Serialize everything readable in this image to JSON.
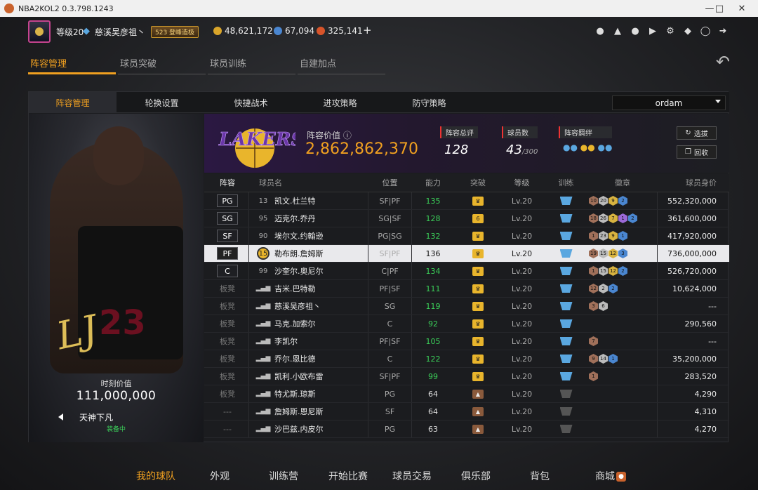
{
  "window": {
    "title": "NBA2KOL2 0.3.798.1243"
  },
  "topbar": {
    "level": "等级20",
    "username": "慈溪吴彦祖丶",
    "badge": "523 登峰造极",
    "coins_gold": "48,621,172",
    "coins_blue": "67,094",
    "coins_red": "325,141",
    "plus": "+"
  },
  "main_tabs": [
    "阵容管理",
    "球员突破",
    "球员训练",
    "自建加点"
  ],
  "sub_tabs": [
    "阵容管理",
    "轮换设置",
    "快捷战术",
    "进攻策略",
    "防守策略"
  ],
  "dropdown": {
    "value": "ordam"
  },
  "card": {
    "value_label": "时刻价值",
    "value": "111,000,000",
    "name": "天神下凡",
    "status": "装备中"
  },
  "team": {
    "lineup_value_label": "阵容价值",
    "lineup_value": "2,862,862,370",
    "rating_label": "阵容总评",
    "rating": "128",
    "count_label": "球员数",
    "count": "43",
    "count_max": "/300",
    "chem_label": "阵容羁绊",
    "btn_select": "选拔",
    "btn_recycle": "回收"
  },
  "table": {
    "headers": [
      "阵容",
      "球员名",
      "位置",
      "能力",
      "突破",
      "等级",
      "训练",
      "徽章",
      "球员身价"
    ],
    "rows": [
      {
        "slot": "PG",
        "starter": true,
        "num": "13",
        "name": "凯文.杜兰特",
        "pos": "SF|PF",
        "ability": "135",
        "level": "Lv.20",
        "value": "552,320,000",
        "break": "gold",
        "badges": [
          [
            "br",
            "10"
          ],
          [
            "si",
            "20"
          ],
          [
            "go",
            "9"
          ],
          [
            "bl",
            "2"
          ]
        ]
      },
      {
        "slot": "SG",
        "starter": true,
        "num": "95",
        "name": "迈克尔.乔丹",
        "pos": "SG|SF",
        "ability": "128",
        "level": "Lv.20",
        "value": "361,600,000",
        "break": "gold6",
        "badges": [
          [
            "br",
            "18"
          ],
          [
            "si",
            "26"
          ],
          [
            "go",
            "7"
          ],
          [
            "pu",
            "1"
          ],
          [
            "bl",
            "2"
          ]
        ]
      },
      {
        "slot": "SF",
        "starter": true,
        "num": "90",
        "name": "埃尔文.约翰逊",
        "pos": "PG|SG",
        "ability": "132",
        "level": "Lv.20",
        "value": "417,920,000",
        "break": "gold",
        "badges": [
          [
            "br",
            "1"
          ],
          [
            "si",
            "23"
          ],
          [
            "go",
            "9"
          ],
          [
            "bl",
            "1"
          ]
        ]
      },
      {
        "slot": "PF",
        "starter": true,
        "selected": true,
        "num": "15",
        "name": "勒布朗.詹姆斯",
        "pos": "SF|PF",
        "ability": "136",
        "level": "Lv.20",
        "value": "736,000,000",
        "break": "gold",
        "badges": [
          [
            "br",
            "19"
          ],
          [
            "si",
            "15"
          ],
          [
            "go",
            "12"
          ],
          [
            "bl",
            "3"
          ]
        ]
      },
      {
        "slot": "C",
        "starter": true,
        "num": "99",
        "name": "沙奎尔.奥尼尔",
        "pos": "C|PF",
        "ability": "134",
        "level": "Lv.20",
        "value": "526,720,000",
        "break": "gold",
        "badges": [
          [
            "br",
            "1"
          ],
          [
            "si",
            "15"
          ],
          [
            "go",
            "12"
          ],
          [
            "bl",
            "2"
          ]
        ]
      },
      {
        "slot": "板凳",
        "starter": false,
        "num": "",
        "name": "吉米.巴特勒",
        "pos": "PF|SF",
        "ability": "111",
        "level": "Lv.20",
        "value": "10,624,000",
        "break": "gold",
        "badges": [
          [
            "br",
            "12"
          ],
          [
            "si",
            "2"
          ],
          [
            "bl",
            "2"
          ]
        ]
      },
      {
        "slot": "板凳",
        "starter": false,
        "num": "",
        "name": "慈溪吴彦祖丶",
        "pos": "SG",
        "ability": "119",
        "level": "Lv.20",
        "value": "---",
        "break": "gold",
        "badges": [
          [
            "br",
            "3"
          ],
          [
            "si",
            "6"
          ]
        ]
      },
      {
        "slot": "板凳",
        "starter": false,
        "num": "",
        "name": "马克.加索尔",
        "pos": "C",
        "ability": "92",
        "level": "Lv.20",
        "value": "290,560",
        "break": "gold",
        "badges": []
      },
      {
        "slot": "板凳",
        "starter": false,
        "num": "",
        "name": "李凯尔",
        "pos": "PF|SF",
        "ability": "105",
        "level": "Lv.20",
        "value": "---",
        "break": "gold",
        "badges": [
          [
            "br",
            "7"
          ]
        ]
      },
      {
        "slot": "板凳",
        "starter": false,
        "num": "",
        "name": "乔尔.恩比德",
        "pos": "C",
        "ability": "122",
        "level": "Lv.20",
        "value": "35,200,000",
        "break": "gold",
        "badges": [
          [
            "br",
            "9"
          ],
          [
            "si",
            "14"
          ],
          [
            "bl",
            "1"
          ]
        ]
      },
      {
        "slot": "板凳",
        "starter": false,
        "num": "",
        "name": "凯利.小欧布雷",
        "pos": "SF|PF",
        "ability": "99",
        "level": "Lv.20",
        "value": "283,520",
        "break": "gold",
        "badges": [
          [
            "br",
            "1"
          ]
        ]
      },
      {
        "slot": "板凳",
        "starter": false,
        "num": "",
        "name": "特尤斯.琼斯",
        "pos": "PG",
        "ability": "64",
        "level": "Lv.20",
        "value": "4,290",
        "break": "bronze",
        "badges": []
      },
      {
        "slot": "---",
        "starter": false,
        "num": "",
        "name": "詹姆斯.恩尼斯",
        "pos": "SF",
        "ability": "64",
        "level": "Lv.20",
        "value": "4,310",
        "break": "bronze",
        "badges": []
      },
      {
        "slot": "---",
        "starter": false,
        "num": "",
        "name": "沙巴兹.内皮尔",
        "pos": "PG",
        "ability": "63",
        "level": "Lv.20",
        "value": "4,270",
        "break": "bronze",
        "badges": []
      }
    ]
  },
  "bottom_nav": [
    "我的球队",
    "外观",
    "训练营",
    "开始比赛",
    "球员交易",
    "俱乐部",
    "背包",
    "商城"
  ],
  "colors": {
    "accent": "#f0a020",
    "green": "#3bcf59",
    "lakers_purple": "#552583"
  }
}
